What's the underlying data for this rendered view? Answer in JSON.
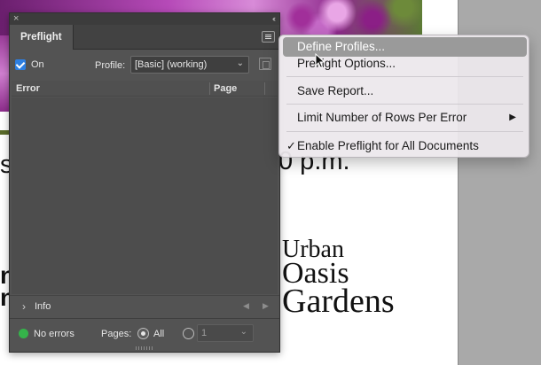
{
  "document": {
    "time_text": "0 p.m.",
    "left_fragment": "s",
    "bold_fragment_1": "n",
    "bold_fragment_2": "n",
    "title_line1": "Urban",
    "title_line2": "Oasis",
    "title_line3": "Gardens"
  },
  "panel": {
    "close_glyph": "×",
    "collapse_glyph": "‹‹",
    "tab_label": "Preflight",
    "on_checked": true,
    "on_label": "On",
    "profile_label": "Profile:",
    "profile_value": "[Basic] (working)",
    "columns": {
      "error": "Error",
      "page": "Page"
    },
    "errors": [],
    "info_label": "Info",
    "info_chevron": "›",
    "prev_glyph": "◀",
    "next_glyph": "▶",
    "status_text": "No errors",
    "status_color": "#35b34a",
    "pages_label": "Pages:",
    "all_label": "All",
    "range_value": "1",
    "accent_color": "#2d7fe2"
  },
  "menu": {
    "define_profiles": "Define Profiles...",
    "preflight_options": "Preflight Options...",
    "save_report": "Save Report...",
    "limit_rows": "Limit Number of Rows Per Error",
    "enable_all": "Enable Preflight for All Documents",
    "highlighted_item": "define_profiles",
    "check_glyph": "✓",
    "submenu_glyph": "▶"
  }
}
